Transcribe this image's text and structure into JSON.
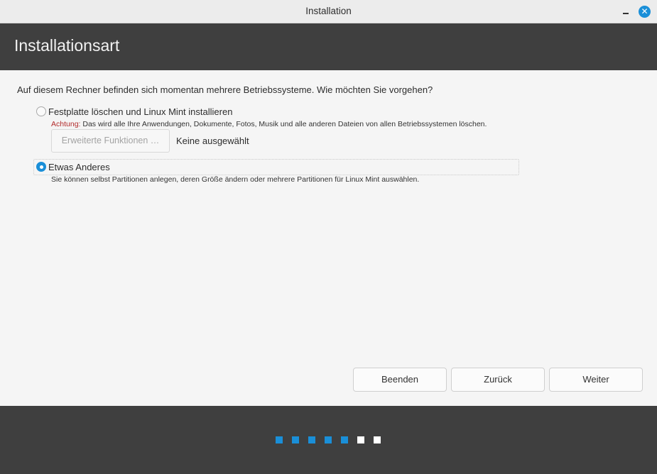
{
  "window": {
    "title": "Installation"
  },
  "header": {
    "title": "Installationsart"
  },
  "question": "Auf diesem Rechner befinden sich momentan mehrere Betriebssysteme. Wie möchten Sie vorgehen?",
  "options": [
    {
      "label": "Festplatte löschen und Linux Mint installieren",
      "checked": false,
      "warning_prefix": "Achtung:",
      "description": " Das wird alle Ihre Anwendungen, Dokumente, Fotos, Musik und alle anderen Dateien von allen Betriebssystemen löschen.",
      "advanced_button": "Erweiterte Funktionen …",
      "selection_status": "Keine ausgewählt"
    },
    {
      "label": "Etwas Anderes",
      "checked": true,
      "description": "Sie können selbst Partitionen anlegen, deren Größe ändern oder mehrere Partitionen für Linux Mint auswählen."
    }
  ],
  "buttons": {
    "quit": "Beenden",
    "back": "Zurück",
    "next": "Weiter"
  },
  "progress": {
    "total_steps": 7,
    "completed_steps": 5,
    "active_color": "#1a8fd8",
    "inactive_color": "#ffffff"
  },
  "colors": {
    "accent": "#1a8fd8",
    "header_bg": "#3f3f3f",
    "warning": "#b22b2b"
  },
  "icons": {
    "minimize": "minimize-icon",
    "close": "close-icon"
  }
}
